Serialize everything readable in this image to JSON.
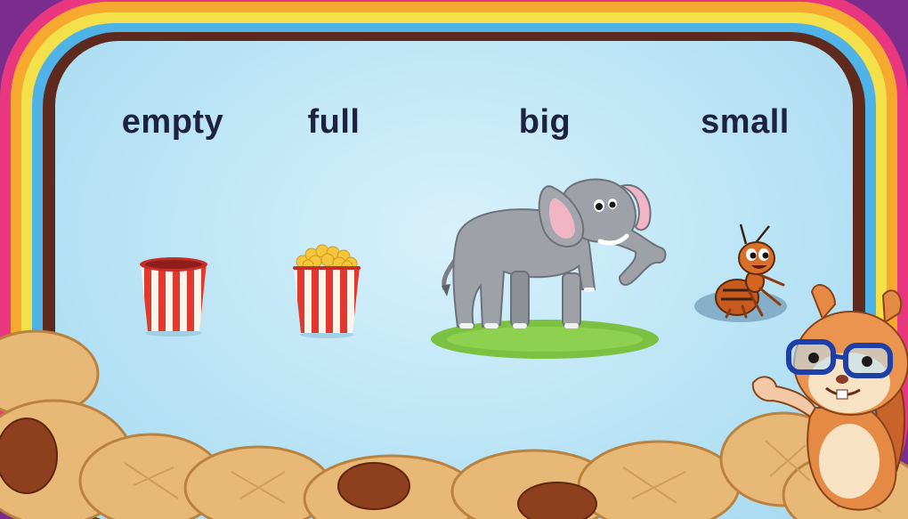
{
  "words": {
    "empty": "empty",
    "full": "full",
    "big": "big",
    "small": "small"
  },
  "colors": {
    "board": "#b8e3f5",
    "frame_pink": "#e8367f",
    "frame_orange": "#f6a92f",
    "frame_yellow": "#f3e04a",
    "frame_blue": "#4fb3e8",
    "frame_brown": "#5e2a1e",
    "text": "#1e2140",
    "peanut": "#e9bd7e"
  },
  "illustrations": {
    "empty": "empty-popcorn-bucket",
    "full": "full-popcorn-bucket",
    "big": "elephant",
    "small": "ant",
    "mascot": "squirrel-with-glasses"
  }
}
